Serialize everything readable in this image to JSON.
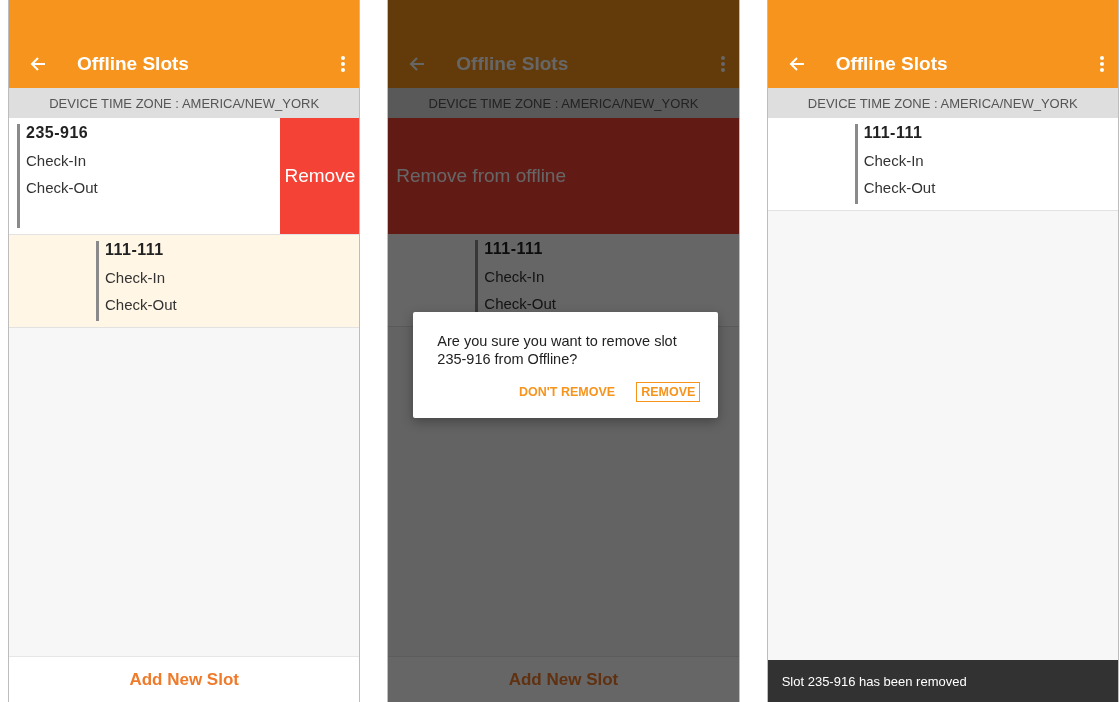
{
  "screens": [
    {
      "app_bar": {
        "title": "Offline Slots"
      },
      "time_zone": "DEVICE TIME ZONE : AMERICA/NEW_YORK",
      "rows": [
        {
          "kind": "swiped",
          "number": "235-916",
          "lines": [
            "Check-In",
            "Check-Out"
          ],
          "highlighted": false,
          "action": "Remove"
        },
        {
          "kind": "slot",
          "number": "111-111",
          "lines": [
            "Check-In",
            "Check-Out"
          ],
          "highlighted": true
        }
      ],
      "footer_button": "Add New Slot"
    },
    {
      "dimmed": true,
      "app_bar": {
        "title": "Offline Slots"
      },
      "time_zone": "DEVICE TIME ZONE : AMERICA/NEW_YORK",
      "rows": [
        {
          "kind": "removing",
          "label": "Remove from offline"
        },
        {
          "kind": "slot",
          "number": "111-111",
          "lines": [
            "Check-In",
            "Check-Out"
          ]
        }
      ],
      "footer_button": "Add New Slot",
      "dialog": {
        "message": "Are you sure you want to remove slot 235-916 from Offline?",
        "buttons": [
          {
            "label": "DON'T REMOVE",
            "focused": false
          },
          {
            "label": "REMOVE",
            "focused": true
          }
        ]
      }
    },
    {
      "app_bar": {
        "title": "Offline Slots"
      },
      "time_zone": "DEVICE TIME ZONE : AMERICA/NEW_YORK",
      "rows": [
        {
          "kind": "slot",
          "number": "111-111",
          "lines": [
            "Check-In",
            "Check-Out"
          ],
          "highlighted": false
        }
      ],
      "snackbar": "Slot 235-916 has been removed"
    }
  ]
}
